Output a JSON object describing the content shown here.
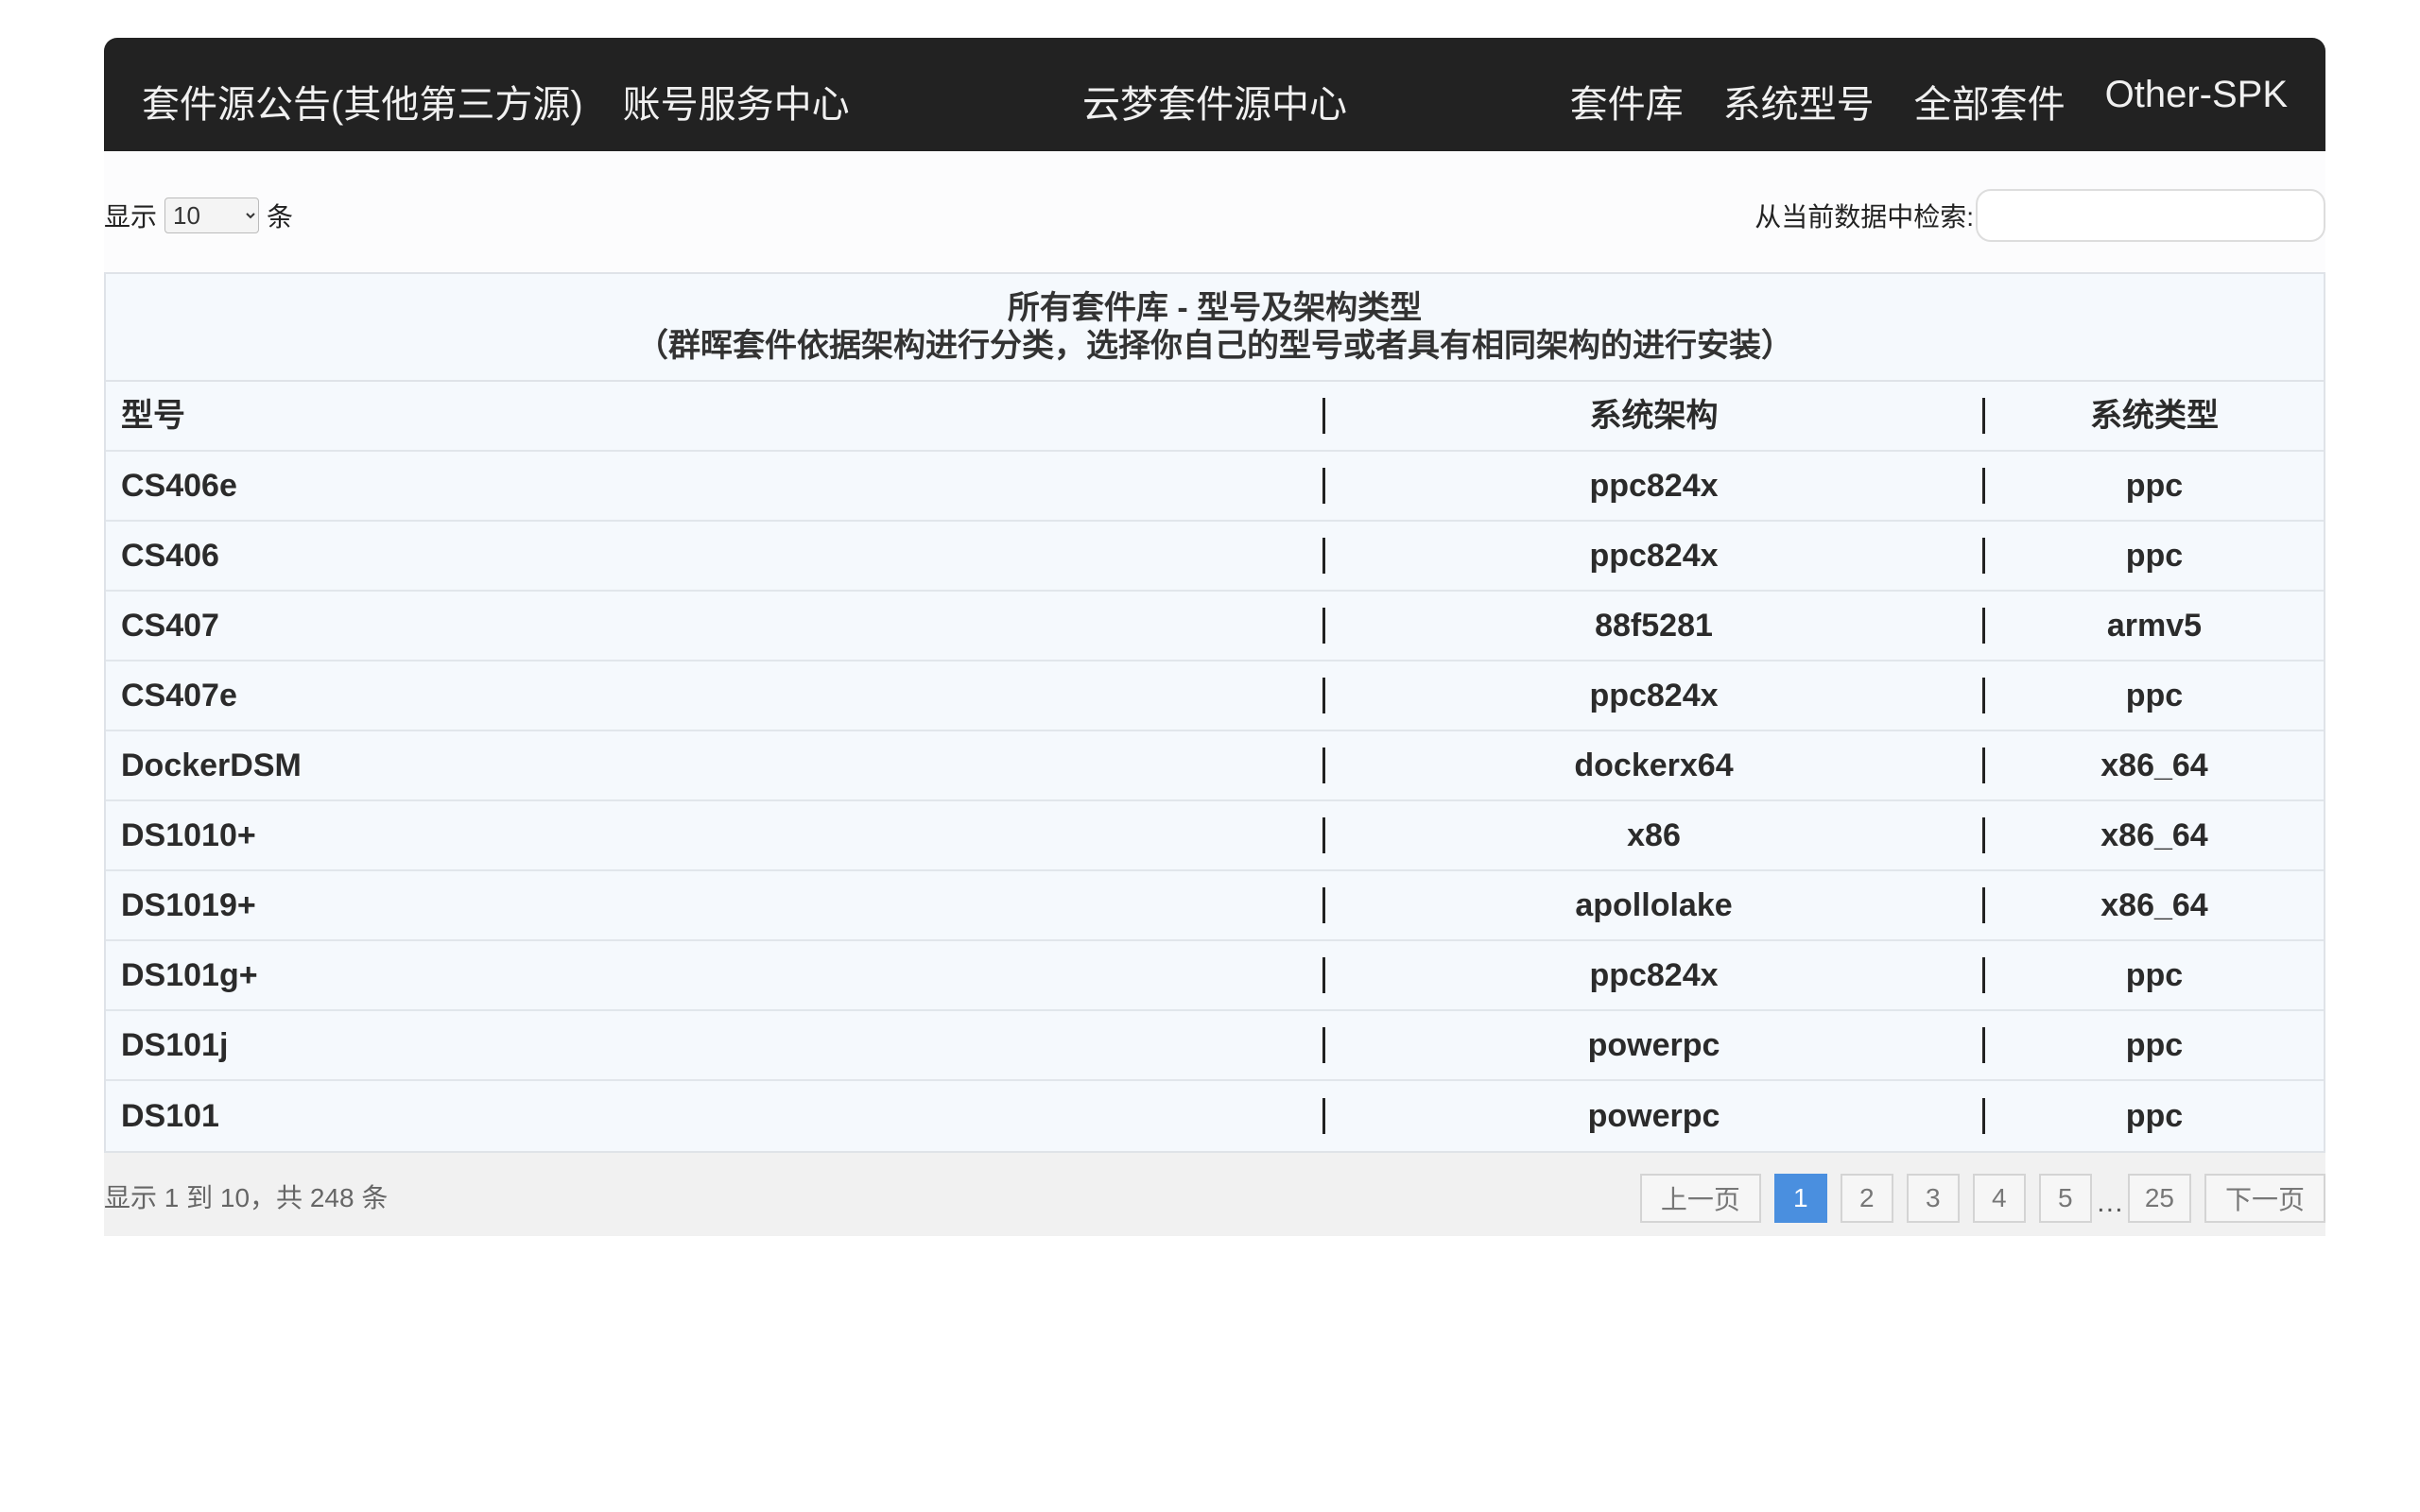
{
  "nav": {
    "left": [
      "套件源公告(其他第三方源)",
      "账号服务中心"
    ],
    "brand": "云梦套件源中心",
    "right": [
      "套件库",
      "系统型号",
      "全部套件",
      "Other-SPK"
    ]
  },
  "controls": {
    "length_prefix": "显示",
    "length_value": "10",
    "length_suffix": "条",
    "search_label": "从当前数据中检索:",
    "search_value": ""
  },
  "table": {
    "caption_line1": "所有套件库 - 型号及架构类型",
    "caption_line2": "（群晖套件依据架构进行分类，选择你自己的型号或者具有相同架构的进行安装）",
    "headers": [
      "型号",
      "系统架构",
      "系统类型"
    ],
    "rows": [
      [
        "CS406e",
        "ppc824x",
        "ppc"
      ],
      [
        "CS406",
        "ppc824x",
        "ppc"
      ],
      [
        "CS407",
        "88f5281",
        "armv5"
      ],
      [
        "CS407e",
        "ppc824x",
        "ppc"
      ],
      [
        "DockerDSM",
        "dockerx64",
        "x86_64"
      ],
      [
        "DS1010+",
        "x86",
        "x86_64"
      ],
      [
        "DS1019+",
        "apollolake",
        "x86_64"
      ],
      [
        "DS101g+",
        "ppc824x",
        "ppc"
      ],
      [
        "DS101j",
        "powerpc",
        "ppc"
      ],
      [
        "DS101",
        "powerpc",
        "ppc"
      ]
    ]
  },
  "footer": {
    "info": "显示 1 到 10，共 248 条",
    "prev": "上一页",
    "pages": [
      "1",
      "2",
      "3",
      "4",
      "5"
    ],
    "ellipsis": "…",
    "last_page": "25",
    "next": "下一页",
    "current_page": "1"
  },
  "colors": {
    "nav_bg": "#222222",
    "table_bg": "#f5f9fd",
    "pager_active": "#4a8fdf"
  }
}
